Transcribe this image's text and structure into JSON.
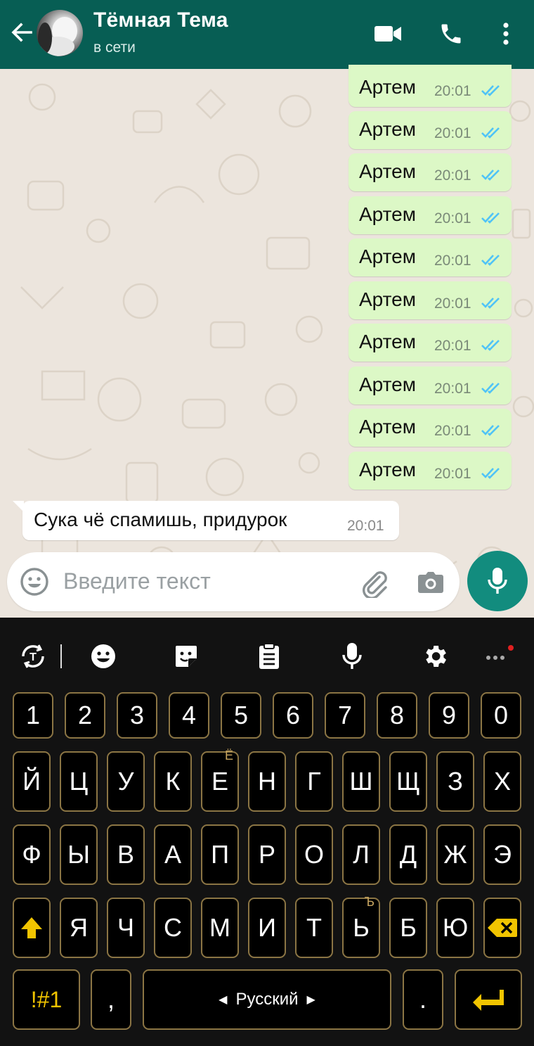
{
  "header": {
    "title": "Тёмная Тема",
    "status": "в сети"
  },
  "messages_out": [
    {
      "text": "Артем",
      "time": "20:01"
    },
    {
      "text": "Артем",
      "time": "20:01"
    },
    {
      "text": "Артем",
      "time": "20:01"
    },
    {
      "text": "Артем",
      "time": "20:01"
    },
    {
      "text": "Артем",
      "time": "20:01"
    },
    {
      "text": "Артем",
      "time": "20:01"
    },
    {
      "text": "Артем",
      "time": "20:01"
    },
    {
      "text": "Артем",
      "time": "20:01"
    },
    {
      "text": "Артем",
      "time": "20:01"
    },
    {
      "text": "Артем",
      "time": "20:01"
    }
  ],
  "message_in": {
    "text": "Сука чё спамишь, придурок",
    "time": "20:01"
  },
  "composer": {
    "placeholder": "Введите текст"
  },
  "keyboard": {
    "toolbar": [
      "translate-icon",
      "emoji-icon",
      "sticker-icon",
      "clipboard-icon",
      "mic-icon",
      "settings-icon",
      "more-icon"
    ],
    "row_numbers": [
      "1",
      "2",
      "3",
      "4",
      "5",
      "6",
      "7",
      "8",
      "9",
      "0"
    ],
    "row1": [
      "Й",
      "Ц",
      "У",
      "К",
      "Е",
      "Н",
      "Г",
      "Ш",
      "Щ",
      "З",
      "Х"
    ],
    "row1_hint_e": "Ё",
    "row2": [
      "Ф",
      "Ы",
      "В",
      "А",
      "П",
      "Р",
      "О",
      "Л",
      "Д",
      "Ж",
      "Э"
    ],
    "row3": [
      "Я",
      "Ч",
      "С",
      "М",
      "И",
      "Т",
      "Ь",
      "Б",
      "Ю"
    ],
    "row3_hint_soft": "Ъ",
    "symbols_label": "!#1",
    "comma": ",",
    "space_label": "Русский",
    "period": ".",
    "accent_color": "#f1c400",
    "key_border_color": "#8b7544"
  },
  "colors": {
    "header_bg": "#075e54",
    "outgoing_bubble": "#dcf8c6",
    "incoming_bubble": "#ffffff",
    "chat_bg": "#ece5dd",
    "read_ticks": "#4fc3f7",
    "mic_button": "#128c7e"
  }
}
